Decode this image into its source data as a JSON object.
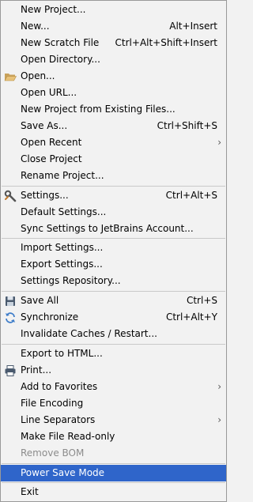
{
  "menu": {
    "new_project": "New Project...",
    "new": "New...",
    "new_shortcut": "Alt+Insert",
    "new_scratch": "New Scratch File",
    "new_scratch_shortcut": "Ctrl+Alt+Shift+Insert",
    "open_directory": "Open Directory...",
    "open": "Open...",
    "open_url": "Open URL...",
    "new_from_existing": "New Project from Existing Files...",
    "save_as": "Save As...",
    "save_as_shortcut": "Ctrl+Shift+S",
    "open_recent": "Open Recent",
    "close_project": "Close Project",
    "rename_project": "Rename Project...",
    "settings": "Settings...",
    "settings_shortcut": "Ctrl+Alt+S",
    "default_settings": "Default Settings...",
    "sync_settings": "Sync Settings to JetBrains Account...",
    "import_settings": "Import Settings...",
    "export_settings": "Export Settings...",
    "settings_repository": "Settings Repository...",
    "save_all": "Save All",
    "save_all_shortcut": "Ctrl+S",
    "synchronize": "Synchronize",
    "synchronize_shortcut": "Ctrl+Alt+Y",
    "invalidate_caches": "Invalidate Caches / Restart...",
    "export_html": "Export to HTML...",
    "print": "Print...",
    "add_favorites": "Add to Favorites",
    "file_encoding": "File Encoding",
    "line_separators": "Line Separators",
    "make_read_only": "Make File Read-only",
    "remove_bom": "Remove BOM",
    "power_save_mode": "Power Save Mode",
    "exit": "Exit"
  },
  "icons": {
    "open": "folder-icon",
    "settings": "wrench-icon",
    "save_all": "floppy-disk-icon",
    "synchronize": "sync-icon",
    "print": "printer-icon",
    "submenu": "chevron-right-icon"
  },
  "colors": {
    "background": "#f2f2f2",
    "selection": "#2f65ca",
    "disabled_text": "#8c8c8c"
  }
}
